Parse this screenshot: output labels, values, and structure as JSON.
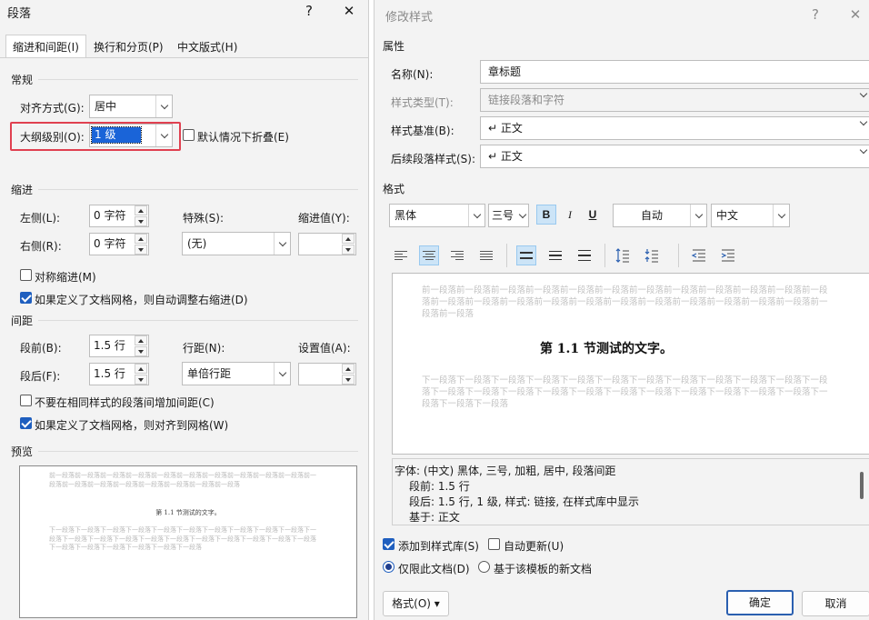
{
  "paragraph_dialog": {
    "title": "段落",
    "help_label": "?",
    "close_label": "✕",
    "tabs": [
      {
        "label": "缩进和间距(I)"
      },
      {
        "label": "换行和分页(P)"
      },
      {
        "label": "中文版式(H)"
      }
    ],
    "general": {
      "group_title": "常规",
      "alignment_label": "对齐方式(G):",
      "alignment_value": "居中",
      "outline_label": "大纲级别(O):",
      "outline_value": "1 级",
      "collapsed_label": "默认情况下折叠(E)",
      "collapsed_checked": false
    },
    "indent": {
      "group_title": "缩进",
      "left_label": "左侧(L):",
      "left_value": "0 字符",
      "right_label": "右侧(R):",
      "right_value": "0 字符",
      "special_label": "特殊(S):",
      "special_value": "(无)",
      "by_label": "缩进值(Y):",
      "by_value": "",
      "mirror_label": "对称缩进(M)",
      "mirror_checked": false,
      "auto_adjust_label": "如果定义了文档网格，则自动调整右缩进(D)",
      "auto_adjust_checked": true
    },
    "spacing": {
      "group_title": "间距",
      "before_label": "段前(B):",
      "before_value": "1.5 行",
      "after_label": "段后(F):",
      "after_value": "1.5 行",
      "line_label": "行距(N):",
      "line_value": "单倍行距",
      "at_label": "设置值(A):",
      "at_value": "",
      "no_space_same_style_label": "不要在相同样式的段落间增加间距(C)",
      "no_space_same_style_checked": false,
      "snap_grid_label": "如果定义了文档网格，则对齐到网格(W)",
      "snap_grid_checked": true
    },
    "preview": {
      "group_title": "预览",
      "prev_text": "前一段落前一段落前一段落前一段落前一段落前一段落前一段落前一段落前一段落前一段落前一段落前一段落前一段落前一段落前一段落前一段落前一段落前一段落",
      "heading": "第 1.1 节测试的文字。",
      "next_text": "下一段落下一段落下一段落下一段落下一段落下一段落下一段落下一段落下一段落下一段落下一段落下一段落下一段落下一段落下一段落下一段落下一段落下一段落下一段落下一段落下一段落下一段落下一段落下一段落下一段落下一段落下一段落"
    }
  },
  "modify_style_dialog": {
    "title": "修改样式",
    "help_label": "?",
    "close_label": "✕",
    "properties": {
      "group_title": "属性",
      "name_label": "名称(N):",
      "name_value": "章标题",
      "type_label": "样式类型(T):",
      "type_value": "链接段落和字符",
      "based_on_label": "样式基准(B):",
      "based_on_value": "↵ 正文",
      "next_style_label": "后续段落样式(S):",
      "next_style_value": "↵ 正文"
    },
    "formatting": {
      "group_title": "格式",
      "font_value": "黑体",
      "size_value": "三号",
      "bold_label": "B",
      "italic_label": "I",
      "underline_label": "U",
      "color_value": "自动",
      "script_value": "中文"
    },
    "preview": {
      "prev_text": "前一段落前一段落前一段落前一段落前一段落前一段落前一段落前一段落前一段落前一段落前一段落前一段落前一段落前一段落前一段落前一段落前一段落前一段落前一段落前一段落前一段落前一段落前一段落前一段落前一段落",
      "heading": "第 1.1 节测试的文字。",
      "next_text": "下一段落下一段落下一段落下一段落下一段落下一段落下一段落下一段落下一段落下一段落下一段落下一段落下一段落下一段落下一段落下一段落下一段落下一段落下一段落下一段落下一段落下一段落下一段落下一段落下一段落下一段落"
    },
    "description": {
      "line1": "字体: (中文) 黑体, 三号, 加粗, 居中, 段落间距",
      "line2": "段前: 1.5 行",
      "line3": "段后: 1.5 行, 1 级, 样式: 链接, 在样式库中显示",
      "line4": "基于: 正文"
    },
    "add_to_gallery_label": "添加到样式库(S)",
    "add_to_gallery_checked": true,
    "auto_update_label": "自动更新(U)",
    "auto_update_checked": false,
    "only_doc_label": "仅限此文档(D)",
    "only_doc_selected": true,
    "new_docs_label": "基于该模板的新文档",
    "new_docs_selected": false,
    "format_button_label": "格式(O) ▾",
    "ok_label": "确定",
    "cancel_label": "取消"
  },
  "colors": {
    "highlight": "#e04050",
    "accent": "#1f5fbf",
    "selected_toolbar": "#cce4f7"
  }
}
